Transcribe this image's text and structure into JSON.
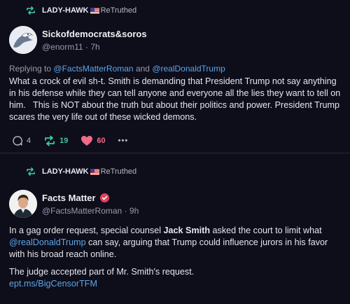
{
  "posts": [
    {
      "retruth_user": "LADY-HAWK",
      "retruth_label": "ReTruthed",
      "author_name": "Sickofdemocrats&soros",
      "author_handle": "@enorm11",
      "time": "· 7h",
      "replying_prefix": "Replying to",
      "replying_mention_1": "@FactsMatterRoman",
      "replying_and": "and",
      "replying_mention_2": "@realDonaldTrump",
      "text": "What a crock of evil sh-t. Smith is demanding that President Trump not say anything in his defense while they can tell anyone and everyone all the lies they want to tell on him.   This is NOT about the truth but about their politics and power. President Trump scares the very life out of these wicked demons.",
      "replies": "4",
      "retruths": "19",
      "likes": "60",
      "more": "•••"
    },
    {
      "retruth_user": "LADY-HAWK",
      "retruth_label": "ReTruthed",
      "author_name": "Facts Matter",
      "author_handle": "@FactsMatterRoman",
      "time": "· 9h",
      "text_part1": "In a gag order request, special counsel ",
      "text_bold": "Jack Smith",
      "text_part2": " asked the court to limit what ",
      "text_mention": "@realDonaldTrump",
      "text_part3": " can say, arguing that Trump could influence jurors in his favor with his broad reach online.",
      "text_para2": "The judge accepted part of Mr. Smith's request.",
      "text_link": "ept.ms/BigCensorTFM"
    }
  ],
  "colors": {
    "background": "#0e0d1a",
    "retruth_green": "#3fc79c",
    "like_pink": "#f06a8a",
    "link_blue": "#5aa7ea",
    "verified_red": "#e0405c"
  }
}
